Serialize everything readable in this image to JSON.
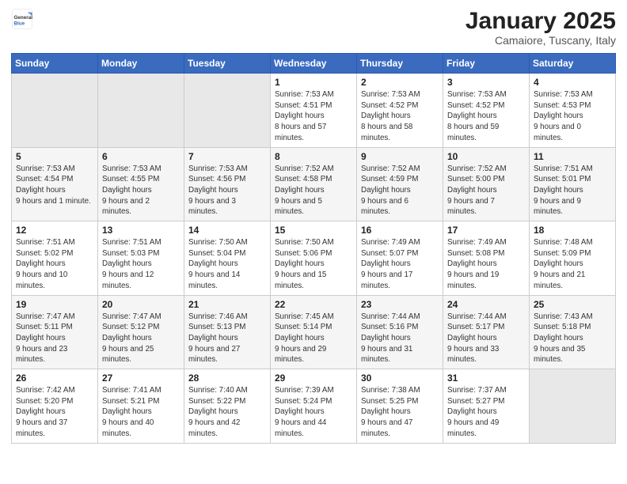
{
  "header": {
    "logo_general": "General",
    "logo_blue": "Blue",
    "title": "January 2025",
    "subtitle": "Camaiore, Tuscany, Italy"
  },
  "days_of_week": [
    "Sunday",
    "Monday",
    "Tuesday",
    "Wednesday",
    "Thursday",
    "Friday",
    "Saturday"
  ],
  "weeks": [
    [
      {
        "day": "",
        "empty": true
      },
      {
        "day": "",
        "empty": true
      },
      {
        "day": "",
        "empty": true
      },
      {
        "day": "1",
        "sunrise": "7:53 AM",
        "sunset": "4:51 PM",
        "daylight": "8 hours and 57 minutes."
      },
      {
        "day": "2",
        "sunrise": "7:53 AM",
        "sunset": "4:52 PM",
        "daylight": "8 hours and 58 minutes."
      },
      {
        "day": "3",
        "sunrise": "7:53 AM",
        "sunset": "4:52 PM",
        "daylight": "8 hours and 59 minutes."
      },
      {
        "day": "4",
        "sunrise": "7:53 AM",
        "sunset": "4:53 PM",
        "daylight": "9 hours and 0 minutes."
      }
    ],
    [
      {
        "day": "5",
        "sunrise": "7:53 AM",
        "sunset": "4:54 PM",
        "daylight": "9 hours and 1 minute."
      },
      {
        "day": "6",
        "sunrise": "7:53 AM",
        "sunset": "4:55 PM",
        "daylight": "9 hours and 2 minutes."
      },
      {
        "day": "7",
        "sunrise": "7:53 AM",
        "sunset": "4:56 PM",
        "daylight": "9 hours and 3 minutes."
      },
      {
        "day": "8",
        "sunrise": "7:52 AM",
        "sunset": "4:58 PM",
        "daylight": "9 hours and 5 minutes."
      },
      {
        "day": "9",
        "sunrise": "7:52 AM",
        "sunset": "4:59 PM",
        "daylight": "9 hours and 6 minutes."
      },
      {
        "day": "10",
        "sunrise": "7:52 AM",
        "sunset": "5:00 PM",
        "daylight": "9 hours and 7 minutes."
      },
      {
        "day": "11",
        "sunrise": "7:51 AM",
        "sunset": "5:01 PM",
        "daylight": "9 hours and 9 minutes."
      }
    ],
    [
      {
        "day": "12",
        "sunrise": "7:51 AM",
        "sunset": "5:02 PM",
        "daylight": "9 hours and 10 minutes."
      },
      {
        "day": "13",
        "sunrise": "7:51 AM",
        "sunset": "5:03 PM",
        "daylight": "9 hours and 12 minutes."
      },
      {
        "day": "14",
        "sunrise": "7:50 AM",
        "sunset": "5:04 PM",
        "daylight": "9 hours and 14 minutes."
      },
      {
        "day": "15",
        "sunrise": "7:50 AM",
        "sunset": "5:06 PM",
        "daylight": "9 hours and 15 minutes."
      },
      {
        "day": "16",
        "sunrise": "7:49 AM",
        "sunset": "5:07 PM",
        "daylight": "9 hours and 17 minutes."
      },
      {
        "day": "17",
        "sunrise": "7:49 AM",
        "sunset": "5:08 PM",
        "daylight": "9 hours and 19 minutes."
      },
      {
        "day": "18",
        "sunrise": "7:48 AM",
        "sunset": "5:09 PM",
        "daylight": "9 hours and 21 minutes."
      }
    ],
    [
      {
        "day": "19",
        "sunrise": "7:47 AM",
        "sunset": "5:11 PM",
        "daylight": "9 hours and 23 minutes."
      },
      {
        "day": "20",
        "sunrise": "7:47 AM",
        "sunset": "5:12 PM",
        "daylight": "9 hours and 25 minutes."
      },
      {
        "day": "21",
        "sunrise": "7:46 AM",
        "sunset": "5:13 PM",
        "daylight": "9 hours and 27 minutes."
      },
      {
        "day": "22",
        "sunrise": "7:45 AM",
        "sunset": "5:14 PM",
        "daylight": "9 hours and 29 minutes."
      },
      {
        "day": "23",
        "sunrise": "7:44 AM",
        "sunset": "5:16 PM",
        "daylight": "9 hours and 31 minutes."
      },
      {
        "day": "24",
        "sunrise": "7:44 AM",
        "sunset": "5:17 PM",
        "daylight": "9 hours and 33 minutes."
      },
      {
        "day": "25",
        "sunrise": "7:43 AM",
        "sunset": "5:18 PM",
        "daylight": "9 hours and 35 minutes."
      }
    ],
    [
      {
        "day": "26",
        "sunrise": "7:42 AM",
        "sunset": "5:20 PM",
        "daylight": "9 hours and 37 minutes."
      },
      {
        "day": "27",
        "sunrise": "7:41 AM",
        "sunset": "5:21 PM",
        "daylight": "9 hours and 40 minutes."
      },
      {
        "day": "28",
        "sunrise": "7:40 AM",
        "sunset": "5:22 PM",
        "daylight": "9 hours and 42 minutes."
      },
      {
        "day": "29",
        "sunrise": "7:39 AM",
        "sunset": "5:24 PM",
        "daylight": "9 hours and 44 minutes."
      },
      {
        "day": "30",
        "sunrise": "7:38 AM",
        "sunset": "5:25 PM",
        "daylight": "9 hours and 47 minutes."
      },
      {
        "day": "31",
        "sunrise": "7:37 AM",
        "sunset": "5:27 PM",
        "daylight": "9 hours and 49 minutes."
      },
      {
        "day": "",
        "empty": true
      }
    ]
  ],
  "labels": {
    "sunrise": "Sunrise:",
    "sunset": "Sunset:",
    "daylight": "Daylight hours"
  }
}
